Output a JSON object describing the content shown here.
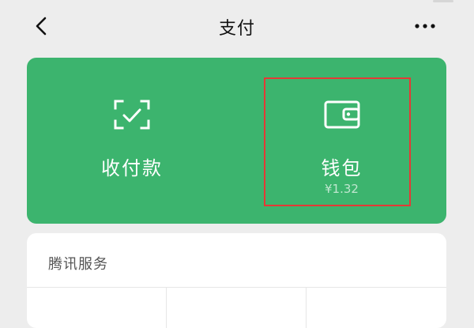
{
  "header": {
    "title": "支付",
    "back_icon": "chevron-left-icon",
    "more_icon": "more-dots-icon"
  },
  "wallet_card": {
    "background": "#3cb46e",
    "actions": [
      {
        "label": "收付款",
        "icon": "scan-check-icon"
      },
      {
        "label": "钱包",
        "balance": "¥1.32",
        "icon": "wallet-icon"
      }
    ],
    "highlight_color": "#e53935"
  },
  "tencent_services": {
    "title": "腾讯服务",
    "grid_cells": 3
  }
}
